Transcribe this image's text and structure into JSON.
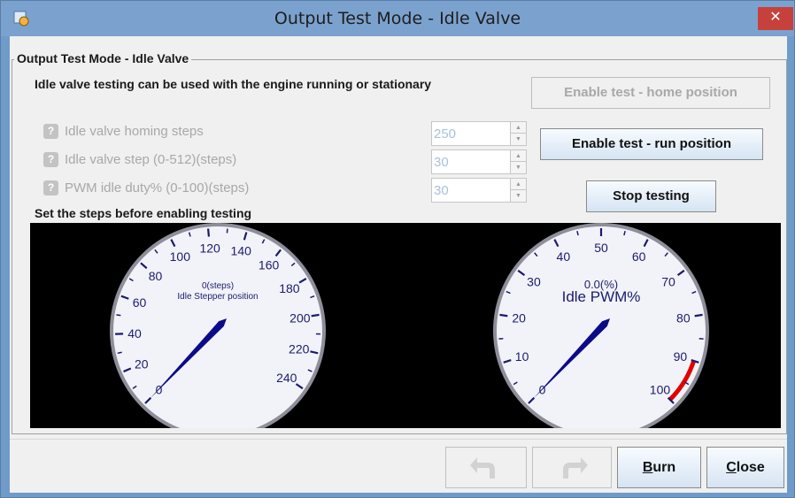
{
  "window": {
    "title": "Output Test Mode - Idle Valve",
    "close_glyph": "✕"
  },
  "group": {
    "title": "Output Test Mode - Idle Valve",
    "description": "Idle valve testing can be used with the engine running or stationary",
    "footer_note": "Set the steps before enabling testing"
  },
  "fields": [
    {
      "label": "Idle valve homing steps",
      "value": "250",
      "help": "?"
    },
    {
      "label": "Idle valve step (0-512)(steps)",
      "value": "30",
      "help": "?"
    },
    {
      "label": "PWM idle duty% (0-100)(steps)",
      "value": "30",
      "help": "?"
    }
  ],
  "buttons": {
    "home": "Enable test - home position",
    "run": "Enable test - run position",
    "stop": "Stop testing"
  },
  "gauge_left": {
    "value_text": "0(steps)",
    "title": "Idle Stepper position",
    "ticks": [
      "0",
      "20",
      "40",
      "60",
      "80",
      "100",
      "120",
      "140",
      "160",
      "180",
      "200",
      "220",
      "240"
    ],
    "value": 0,
    "min": 0,
    "max": 250
  },
  "gauge_right": {
    "value_text": "0.0(%)",
    "title": "Idle PWM%",
    "ticks": [
      "0",
      "10",
      "20",
      "30",
      "40",
      "50",
      "60",
      "70",
      "80",
      "90",
      "100"
    ],
    "value": 0,
    "min": 0,
    "max": 100,
    "redline_from": 90,
    "redline_color": "#e00000"
  },
  "bottom": {
    "undo_icon": "undo-arrow-icon",
    "redo_icon": "redo-arrow-icon",
    "burn": "Burn",
    "burn_mnemonic": "B",
    "burn_rest": "urn",
    "close": "Close",
    "close_mnemonic": "C",
    "close_rest": "lose"
  },
  "colors": {
    "needle": "#0b0b8a",
    "gauge_text": "#1b1b6e",
    "disabled_text": "#a8a8a8",
    "titlebar": "#7ba2ce"
  }
}
